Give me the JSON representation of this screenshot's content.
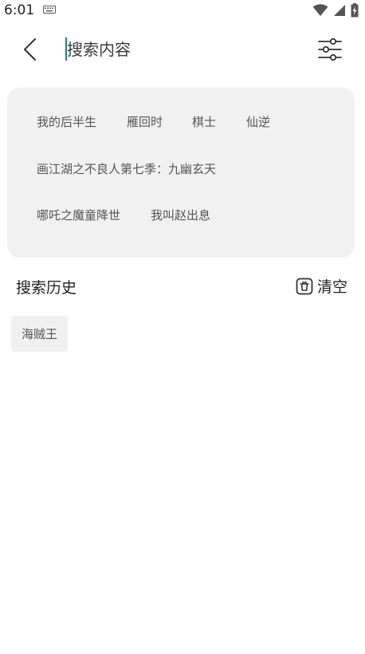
{
  "status_bar": {
    "time": "6:01",
    "icons": [
      "keyboard-icon",
      "wifi-icon",
      "signal-icon",
      "battery-charging-icon"
    ]
  },
  "search": {
    "placeholder": "搜索内容",
    "value": ""
  },
  "hot_tags": {
    "rows": [
      [
        "我的后半生",
        "雁回时",
        "棋士",
        "仙逆"
      ],
      [
        "画江湖之不良人第七季：九幽玄天"
      ],
      [
        "哪吒之魔童降世",
        "我叫赵出息"
      ]
    ]
  },
  "history": {
    "title": "搜索历史",
    "clear_label": "清空",
    "items": [
      "海贼王"
    ]
  }
}
